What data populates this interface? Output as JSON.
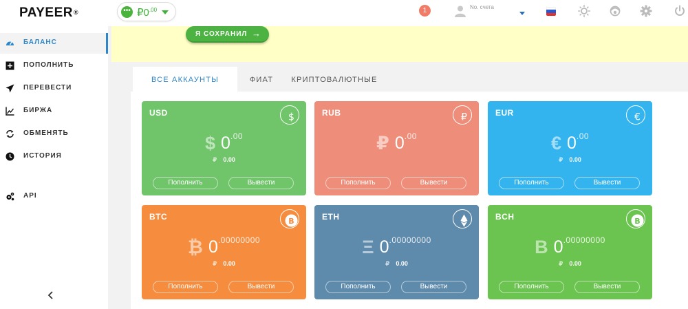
{
  "header": {
    "logo": "PAYEER",
    "logo_mark": "®",
    "balance_symbol": "₽",
    "balance_value": "0",
    "balance_frac": ".00",
    "notifications_count": "1",
    "account_label": "No. счета"
  },
  "sidebar": {
    "items": [
      {
        "label": "БАЛАНС",
        "icon": "speedometer-icon",
        "active": true
      },
      {
        "label": "ПОПОЛНИТЬ",
        "icon": "plus-square-icon",
        "active": false
      },
      {
        "label": "ПЕРЕВЕСТИ",
        "icon": "paper-plane-icon",
        "active": false
      },
      {
        "label": "БИРЖА",
        "icon": "chart-icon",
        "active": false
      },
      {
        "label": "ОБМЕНЯТЬ",
        "icon": "exchange-icon",
        "active": false
      },
      {
        "label": "ИСТОРИЯ",
        "icon": "clock-icon",
        "active": false
      },
      {
        "label": "API",
        "icon": "gears-icon",
        "active": false
      }
    ]
  },
  "notice": {
    "button_label": "Я СОХРАНИЛ",
    "arrow": "→"
  },
  "tabs": [
    {
      "label": "ВСЕ АККАУНТЫ",
      "active": true
    },
    {
      "label": "ФИАТ",
      "active": false
    },
    {
      "label": "КРИПТОВАЛЮТНЫЕ",
      "active": false
    }
  ],
  "cards": [
    {
      "currency": "USD",
      "symbol": "$",
      "icon": "dollar-icon",
      "amount": "0",
      "frac": ".00",
      "rub_symbol": "₽",
      "rub_value": "0.00",
      "deposit": "Пополнить",
      "withdraw": "Вывести",
      "color": "#70c46a"
    },
    {
      "currency": "RUB",
      "symbol": "₽",
      "icon": "ruble-icon",
      "amount": "0",
      "frac": ".00",
      "rub_symbol": "",
      "rub_value": "",
      "deposit": "Пополнить",
      "withdraw": "Вывести",
      "color": "#ee8e7a"
    },
    {
      "currency": "EUR",
      "symbol": "€",
      "icon": "euro-icon",
      "amount": "0",
      "frac": ".00",
      "rub_symbol": "₽",
      "rub_value": "0.00",
      "deposit": "Пополнить",
      "withdraw": "Вывести",
      "color": "#33b4ee"
    },
    {
      "currency": "BTC",
      "symbol": "₿",
      "icon": "bitcoin-icon",
      "amount": "0",
      "frac": ".00000000",
      "rub_symbol": "₽",
      "rub_value": "0.00",
      "deposit": "Пополнить",
      "withdraw": "Вывести",
      "color": "#f68c3e"
    },
    {
      "currency": "ETH",
      "symbol": "Ξ",
      "icon": "ethereum-icon",
      "amount": "0",
      "frac": ".00000000",
      "rub_symbol": "₽",
      "rub_value": "0.00",
      "deposit": "Пополнить",
      "withdraw": "Вывести",
      "color": "#5e8aac"
    },
    {
      "currency": "BCH",
      "symbol": "B",
      "icon": "bitcoin-cash-icon",
      "amount": "0",
      "frac": ".00000000",
      "rub_symbol": "₽",
      "rub_value": "0.00",
      "deposit": "Пополнить",
      "withdraw": "Вывести",
      "color": "#6bc44f"
    }
  ],
  "colors": {
    "accent": "#2e86c9",
    "green": "#4cb342",
    "notice_bg": "#ffffc6"
  }
}
